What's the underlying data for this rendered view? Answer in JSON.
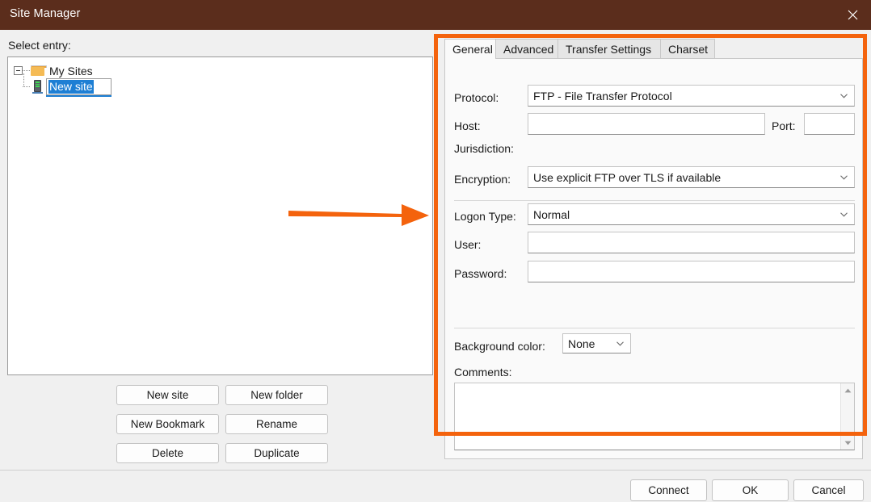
{
  "window": {
    "title": "Site Manager",
    "close_icon": "close-icon"
  },
  "left_pane": {
    "select_entry_label": "Select entry:",
    "tree": {
      "root": {
        "label": "My Sites",
        "icon": "folder-icon",
        "expanded": true
      },
      "child": {
        "icon": "server-icon",
        "editing": true,
        "edit_value": "New site"
      }
    },
    "buttons": [
      {
        "label": "New site"
      },
      {
        "label": "New folder"
      },
      {
        "label": "New Bookmark"
      },
      {
        "label": "Rename"
      },
      {
        "label": "Delete"
      },
      {
        "label": "Duplicate"
      }
    ]
  },
  "right_pane": {
    "tabs": [
      {
        "label": "General",
        "active": true
      },
      {
        "label": "Advanced",
        "active": false
      },
      {
        "label": "Transfer Settings",
        "active": false
      },
      {
        "label": "Charset",
        "active": false
      }
    ],
    "general": {
      "protocol_label": "Protocol:",
      "protocol_value": "FTP - File Transfer Protocol",
      "host_label": "Host:",
      "host_value": "",
      "host_placeholder": "",
      "port_label": "Port:",
      "port_value": "",
      "port_placeholder": "",
      "jurisdiction_label": "Jurisdiction:",
      "encryption_label": "Encryption:",
      "encryption_value": "Use explicit FTP over TLS if available",
      "logon_type_label": "Logon Type:",
      "logon_type_value": "Normal",
      "user_label": "User:",
      "user_value": "",
      "user_placeholder": "",
      "password_label": "Password:",
      "password_value": "",
      "password_placeholder": "",
      "background_color_label": "Background color:",
      "background_color_value": "None",
      "comments_label": "Comments:",
      "comments_value": "",
      "comments_placeholder": ""
    }
  },
  "footer": {
    "connect_label": "Connect",
    "ok_label": "OK",
    "cancel_label": "Cancel"
  },
  "annotations": {
    "highlight_color": "#f4630d",
    "arrow_color": "#f4630d"
  },
  "colors": {
    "titlebar": "#5b2d1c",
    "dialog_background": "#f0f0f0",
    "panel_background": "#fafafa",
    "selection_blue": "#1e7fd4",
    "accent_orange": "#f4630d"
  }
}
